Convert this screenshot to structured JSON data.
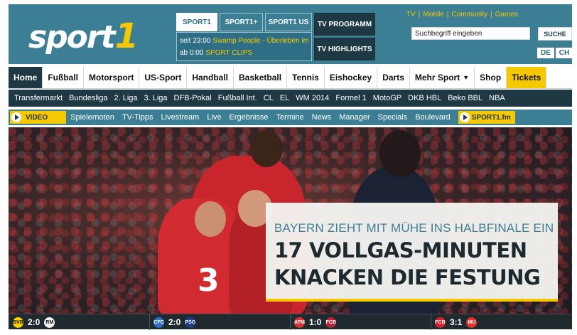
{
  "header": {
    "logo_word": "sport",
    "logo_num": "1",
    "tv_tabs": [
      "SPORT1",
      "SPORT1+",
      "SPORT1 US"
    ],
    "schedule": [
      {
        "time": "seit 23:00",
        "show": "Swamp People - Überleben im S"
      },
      {
        "time": "ab 0:00",
        "show": "SPORT CLIPS"
      }
    ],
    "tv_buttons": [
      "TV PROGRAMM",
      "TV HIGHLIGHTS"
    ],
    "top_links": [
      "TV",
      "Mobile",
      "Community",
      "Games"
    ],
    "search_value": "Suchbegriff eingeben",
    "search_button": "SUCHE",
    "lang": [
      "DE",
      "CH"
    ]
  },
  "main_nav": [
    "Home",
    "Fußball",
    "Motorsport",
    "US-Sport",
    "Handball",
    "Basketball",
    "Tennis",
    "Eishockey",
    "Darts",
    "Mehr Sport",
    "Shop",
    "Tickets"
  ],
  "sub_nav": [
    "Transfermarkt",
    "Bundesliga",
    "2. Liga",
    "3. Liga",
    "DFB-Pokal",
    "Fußball Int.",
    "CL",
    "EL",
    "WM 2014",
    "Formel 1",
    "MotoGP",
    "DKB HBL",
    "Beko BBL",
    "NBA"
  ],
  "media_bar": {
    "video_label": "VIDEO",
    "items": [
      "Spielernoten",
      "TV-Tipps",
      "Livestream",
      "Live",
      "Ergebnisse",
      "Termine",
      "News",
      "Manager",
      "Specials",
      "Boulevard"
    ],
    "fm_label": "SPORT1.fm"
  },
  "hero": {
    "kicker": "BAYERN ZIEHT MIT MÜHE INS HALBFINALE EIN",
    "title_line1": "17 VOLLGAS-MINUTEN",
    "title_line2": "KNACKEN DIE FESTUNG",
    "shirt_number": "3"
  },
  "scores": [
    {
      "home_badge": "BVB",
      "score": "2:0",
      "away_badge": "RM",
      "home_color": "#f6d200",
      "away_color": "#f2f2f2"
    },
    {
      "home_badge": "CFC",
      "score": "2:0",
      "away_badge": "PSG",
      "home_color": "#2f6fc0",
      "away_color": "#1d3f8a"
    },
    {
      "home_badge": "ATM",
      "score": "1:0",
      "away_badge": "FCB",
      "home_color": "#d43333",
      "away_color": "#b3263a"
    },
    {
      "home_badge": "FCB",
      "score": "3:1",
      "away_badge": "MU",
      "home_color": "#d6212d",
      "away_color": "#e0342a"
    }
  ]
}
